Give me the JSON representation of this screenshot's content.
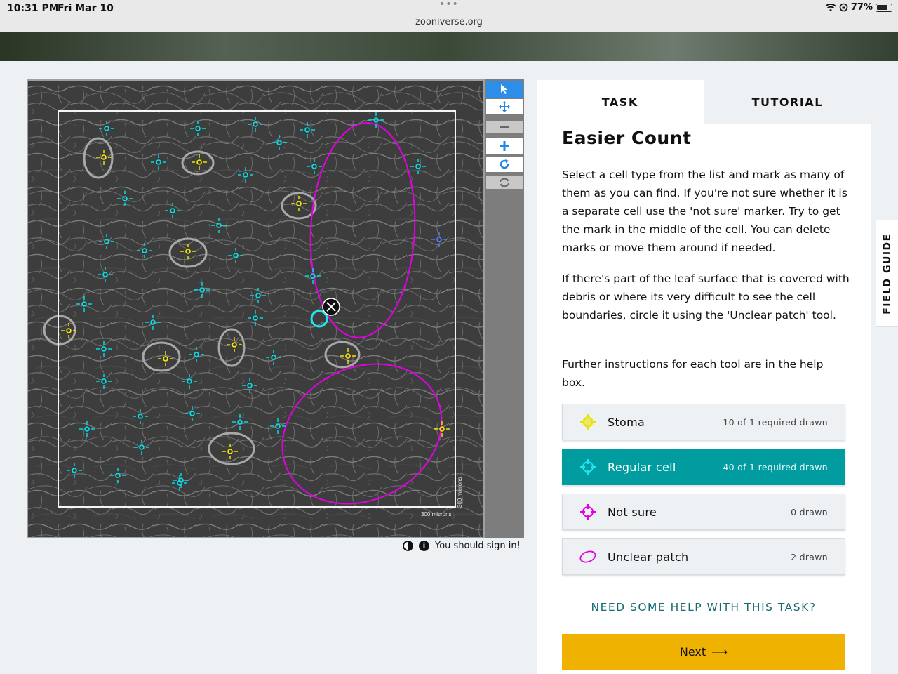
{
  "status_bar": {
    "time": "10:31 PM",
    "date": "Fri Mar 10",
    "url": "zooniverse.org",
    "battery": "77%",
    "icons": [
      "wifi-icon",
      "rotation-lock-icon",
      "battery-icon"
    ]
  },
  "viewer": {
    "scale_label_horizontal": "300 microns",
    "scale_label_vertical": "300 microns",
    "marks": {
      "stoma_color": "#ffee00",
      "regular_color": "#00e5ee",
      "not_sure_color": "#5a7dff",
      "unclear_color": "#e400e4",
      "stoma_count": 10,
      "regular_count": 40,
      "unclear_count": 2
    },
    "tools": [
      "pointer-icon",
      "pan-icon",
      "zoom-out-icon",
      "zoom-in-icon",
      "rotate-icon",
      "reset-icon"
    ]
  },
  "sign_in": {
    "text": "You should sign in!",
    "icons": [
      "invert-icon",
      "info-icon"
    ]
  },
  "panel": {
    "tabs": [
      {
        "label": "TASK",
        "active": true
      },
      {
        "label": "TUTORIAL",
        "active": false
      }
    ],
    "title": "Easier Count",
    "paragraphs": [
      "Select a cell type from the list and mark as many of them as you can find. If you're not sure whether it is a separate cell use the 'not sure' marker. Try to get the mark in the middle of the cell. You can delete marks or move them around if needed.",
      "If there's part of the leaf surface that is covered with debris or where its very difficult to see the cell boundaries, circle it using the 'Unclear patch' tool.",
      "Further instructions for each tool are in the help box."
    ],
    "options": [
      {
        "label": "Stoma",
        "count": "10 of 1 required drawn",
        "icon": "stoma-marker-icon",
        "color": "#e8e200",
        "selected": false
      },
      {
        "label": "Regular cell",
        "count": "40 of 1 required drawn",
        "icon": "regular-cell-marker-icon",
        "color": "#1fe6ee",
        "selected": true
      },
      {
        "label": "Not sure",
        "count": "0 drawn",
        "icon": "not-sure-marker-icon",
        "color": "#e400e4",
        "selected": false
      },
      {
        "label": "Unclear patch",
        "count": "2 drawn",
        "icon": "ellipse-icon",
        "color": "#e400e4",
        "selected": false
      }
    ],
    "help_link": "NEED SOME HELP WITH THIS TASK?",
    "next_label": "Next",
    "next_arrow": "⟶"
  },
  "field_guide": "FIELD GUIDE"
}
